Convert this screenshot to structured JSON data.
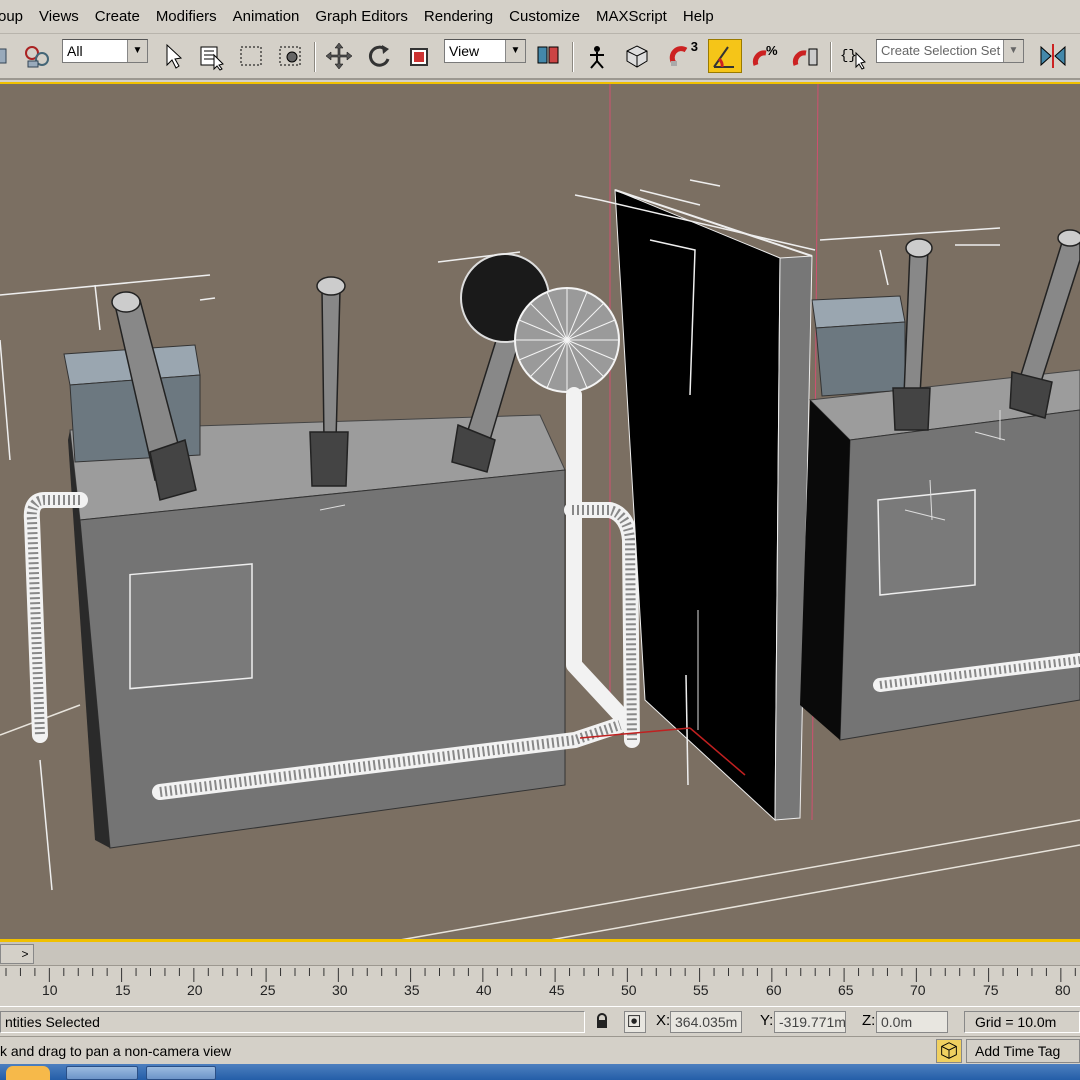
{
  "menu": {
    "items": [
      "oup",
      "Views",
      "Create",
      "Modifiers",
      "Animation",
      "Graph Editors",
      "Rendering",
      "Customize",
      "MAXScript",
      "Help"
    ]
  },
  "toolbar": {
    "selection_filter": "All",
    "reference_coord": "View",
    "selection_set_placeholder": "Create Selection Set",
    "snap_label": "3",
    "icons": [
      "select-link-icon",
      "unlink-icon",
      "select-icon",
      "select-by-name-icon",
      "rect-region-icon",
      "window-crossing-icon",
      "move-icon",
      "rotate-icon",
      "scale-icon",
      "mirror-icon",
      "pivot-icon",
      "manipulate-icon",
      "keyboard-shortcut-icon",
      "snaps-toggle-icon",
      "angle-snap-icon",
      "percent-snap-icon",
      "spinner-snap-icon",
      "named-selection-icon",
      "mirror-tool-icon"
    ]
  },
  "timeline": {
    "ticks": [
      "10",
      "15",
      "20",
      "25",
      "30",
      "35",
      "40",
      "45",
      "50",
      "55",
      "60",
      "65",
      "70",
      "75",
      "80"
    ],
    "slider_arrow": ">"
  },
  "status": {
    "selection_text": "ntities Selected",
    "x_label": "X:",
    "x_value": "364.035m",
    "y_label": "Y:",
    "y_value": "-319.771m",
    "z_label": "Z:",
    "z_value": "0.0m",
    "grid": "Grid = 10.0m",
    "prompt": "k and drag to pan a non-camera view",
    "add_time_tag": "Add Time Tag"
  },
  "colors": {
    "viewport_bg": "#7b6f62",
    "active_border": "#f0c000",
    "ui_bg": "#d4d0c8"
  }
}
